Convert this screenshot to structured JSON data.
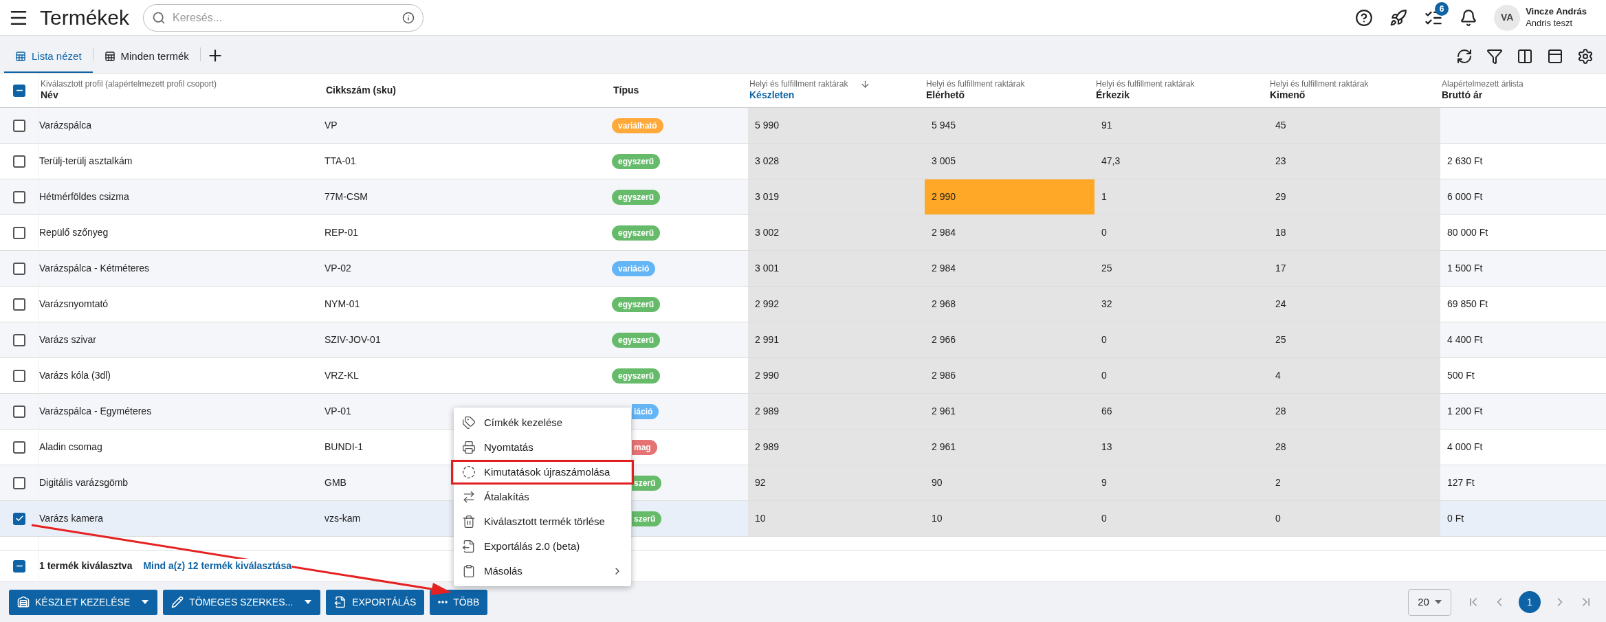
{
  "header": {
    "title": "Termékek",
    "search": {
      "placeholder": "Keresés..."
    },
    "tasks_badge": "6",
    "user": {
      "initials": "VA",
      "name": "Vincze András",
      "subtitle": "Andris teszt"
    }
  },
  "tabs": [
    {
      "label": "Lista nézet",
      "selected": true
    },
    {
      "label": "Minden termék",
      "selected": false
    }
  ],
  "table": {
    "header_indeterminate": true,
    "columns": [
      {
        "group": "Kiválasztott profil (alapértelmezett profil csoport)",
        "label": "Név",
        "sorted": false
      },
      {
        "label": "Cikkszám (sku)",
        "sorted": false
      },
      {
        "label": "Típus",
        "sorted": false
      },
      {
        "group": "Helyi és fulfillment raktárak",
        "label": "Készleten",
        "sorted": true
      },
      {
        "group": "Helyi és fulfillment raktárak",
        "label": "Elérhető",
        "sorted": false
      },
      {
        "group": "Helyi és fulfillment raktárak",
        "label": "Érkezik",
        "sorted": false
      },
      {
        "group": "Helyi és fulfillment raktárak",
        "label": "Kimenő",
        "sorted": false
      },
      {
        "group": "Alapértelmezett árlista",
        "label": "Bruttó ár",
        "sorted": false
      }
    ],
    "rows": [
      {
        "checked": false,
        "name": "Varázspálca",
        "sku": "VP",
        "type": {
          "label": "variálható",
          "color": "#ffa93a",
          "cut": false
        },
        "stock": "5 990",
        "available": "5 945",
        "available_warning": false,
        "incoming": "91",
        "outgoing": "45"
      },
      {
        "checked": false,
        "name": "Terülj-terülj asztalkám",
        "sku": "TTA-01",
        "type": {
          "label": "egyszerű",
          "color": "#66bb6a",
          "cut": false
        },
        "stock": "3 028",
        "available": "3 005",
        "available_warning": false,
        "incoming": "47,3",
        "outgoing": "23",
        "price": "2 630 Ft"
      },
      {
        "checked": false,
        "name": "Hétmérföldes csizma",
        "sku": "77M-CSM",
        "type": {
          "label": "egyszerű",
          "color": "#66bb6a",
          "cut": false
        },
        "stock": "3 019",
        "available": "2 990",
        "available_warning": true,
        "incoming": "1",
        "outgoing": "29",
        "price": "6 000 Ft"
      },
      {
        "checked": false,
        "name": "Repülő szőnyeg",
        "sku": "REP-01",
        "type": {
          "label": "egyszerű",
          "color": "#66bb6a",
          "cut": false
        },
        "stock": "3 002",
        "available": "2 984",
        "available_warning": false,
        "incoming": "0",
        "outgoing": "18",
        "price": "80 000 Ft"
      },
      {
        "checked": false,
        "name": "Varázspálca - Kétméteres",
        "sku": "VP-02",
        "type": {
          "label": "variáció",
          "color": "#64b5f6",
          "cut": false
        },
        "stock": "3 001",
        "available": "2 984",
        "available_warning": false,
        "incoming": "25",
        "outgoing": "17",
        "price": "1 500 Ft"
      },
      {
        "checked": false,
        "name": "Varázsnyomtató",
        "sku": "NYM-01",
        "type": {
          "label": "egyszerű",
          "color": "#66bb6a",
          "cut": false
        },
        "stock": "2 992",
        "available": "2 968",
        "available_warning": false,
        "incoming": "32",
        "outgoing": "24",
        "price": "69 850 Ft"
      },
      {
        "checked": false,
        "name": "Varázs szivar",
        "sku": "SZIV-JOV-01",
        "type": {
          "label": "egyszerű",
          "color": "#66bb6a",
          "cut": false
        },
        "stock": "2 991",
        "available": "2 966",
        "available_warning": false,
        "incoming": "0",
        "outgoing": "25",
        "price": "4 400 Ft"
      },
      {
        "checked": false,
        "name": "Varázs kóla (3dl)",
        "sku": "VRZ-KL",
        "type": {
          "label": "egyszerű",
          "color": "#66bb6a",
          "cut": false
        },
        "stock": "2 990",
        "available": "2 986",
        "available_warning": false,
        "incoming": "0",
        "outgoing": "4",
        "price": "500 Ft"
      },
      {
        "checked": false,
        "name": "Varázspálca - Egyméteres",
        "sku": "VP-01",
        "type": {
          "label": "iáció",
          "color": "#64b5f6",
          "cut": true
        },
        "stock": "2 989",
        "available": "2 961",
        "available_warning": false,
        "incoming": "66",
        "outgoing": "28",
        "price": "1 200 Ft"
      },
      {
        "checked": false,
        "name": "Aladin csomag",
        "sku": "BUNDI-1",
        "type": {
          "label": "mag",
          "color": "#e57373",
          "cut": true
        },
        "stock": "2 989",
        "available": "2 961",
        "available_warning": false,
        "incoming": "13",
        "outgoing": "28",
        "price": "4 000 Ft"
      },
      {
        "checked": false,
        "name": "Digitális varázsgömb",
        "sku": "GMB",
        "type": {
          "label": "szerű",
          "color": "#66bb6a",
          "cut": true
        },
        "stock": "92",
        "available": "90",
        "available_warning": false,
        "incoming": "9",
        "outgoing": "2",
        "price": "127 Ft"
      },
      {
        "checked": true,
        "name": "Varázs kamera",
        "sku": "vzs-kam",
        "type": {
          "label": "szerű",
          "color": "#66bb6a",
          "cut": true
        },
        "stock": "10",
        "available": "10",
        "available_warning": false,
        "incoming": "0",
        "outgoing": "0",
        "price": "0 Ft"
      }
    ]
  },
  "selection_bar": {
    "indeterminate": true,
    "count": "1 termék kiválasztva",
    "select_all": "Mind a(z) 12 termék kiválasztása"
  },
  "actions": [
    {
      "kind": "warehouse",
      "label": "KÉSZLET KEZELÉSE",
      "dropdown": true
    },
    {
      "kind": "edit",
      "label": "TÖMEGES SZERKES...",
      "dropdown": true
    },
    {
      "kind": "export",
      "label": "EXPORTÁLÁS",
      "dropdown": false
    },
    {
      "kind": "more",
      "label": "TÖBB",
      "dropdown": false
    }
  ],
  "menu": [
    {
      "kind": "tags",
      "label": "Címkék kezelése",
      "highlighted": false,
      "submenu": false
    },
    {
      "kind": "print",
      "label": "Nyomtatás",
      "highlighted": false,
      "submenu": false
    },
    {
      "kind": "recalc",
      "label": "Kimutatások újraszámolása",
      "highlighted": true,
      "submenu": false
    },
    {
      "kind": "convert",
      "label": "Átalakítás",
      "highlighted": false,
      "submenu": false
    },
    {
      "kind": "delete",
      "label": "Kiválasztott termék törlése",
      "highlighted": false,
      "submenu": false
    },
    {
      "kind": "export",
      "label": "Exportálás 2.0 (beta)",
      "highlighted": false,
      "submenu": false
    },
    {
      "kind": "copy",
      "label": "Másolás",
      "highlighted": false,
      "submenu": true
    }
  ],
  "pagination": {
    "page_size": "20",
    "pages": [
      {
        "label": "1",
        "selected": true
      }
    ]
  }
}
